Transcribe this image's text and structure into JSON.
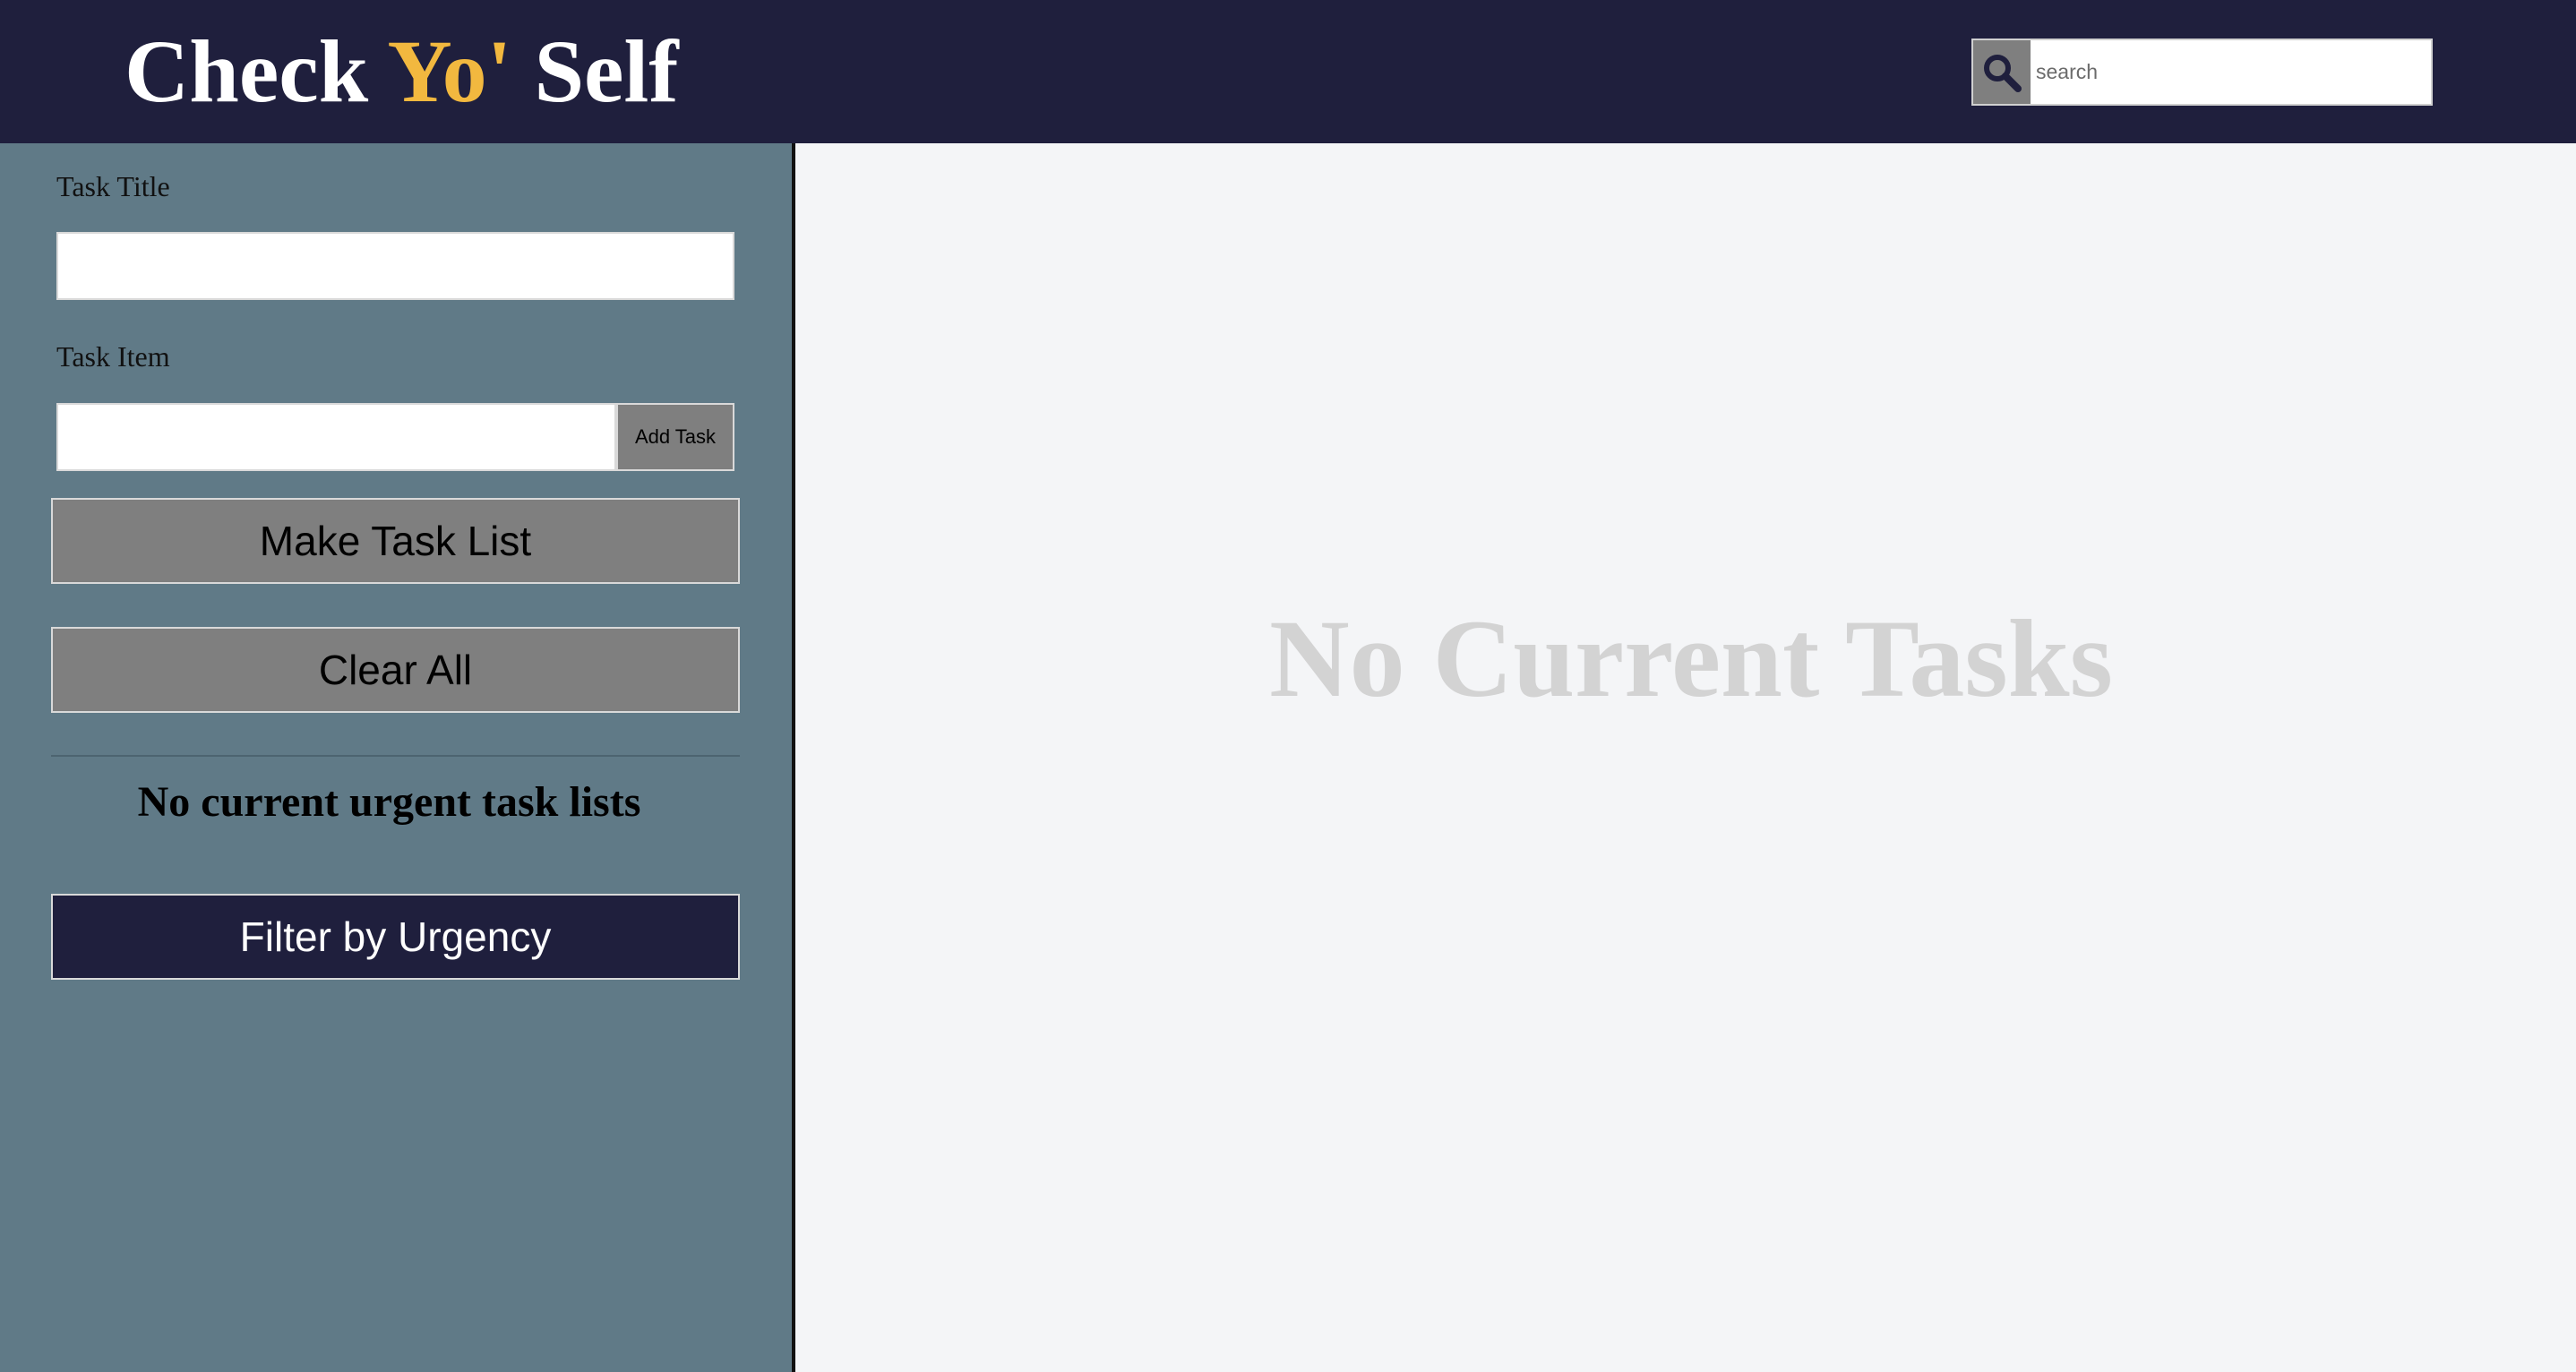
{
  "header": {
    "title_part1": "Check ",
    "title_accent": "Yo'",
    "title_part2": " Self",
    "accent_color": "#f2b83f",
    "background_color": "#1f1f3d",
    "search": {
      "icon": "search-icon",
      "placeholder": "search",
      "value": ""
    }
  },
  "sidebar": {
    "background_color": "#607a87",
    "task_title_label": "Task Title",
    "task_title_value": "",
    "task_item_label": "Task Item",
    "task_item_value": "",
    "add_task_label": "Add Task",
    "make_task_list_label": "Make Task List",
    "clear_all_label": "Clear All",
    "urgent_message": "No current urgent task lists",
    "filter_label": "Filter by Urgency"
  },
  "main": {
    "empty_message": "No Current Tasks"
  }
}
